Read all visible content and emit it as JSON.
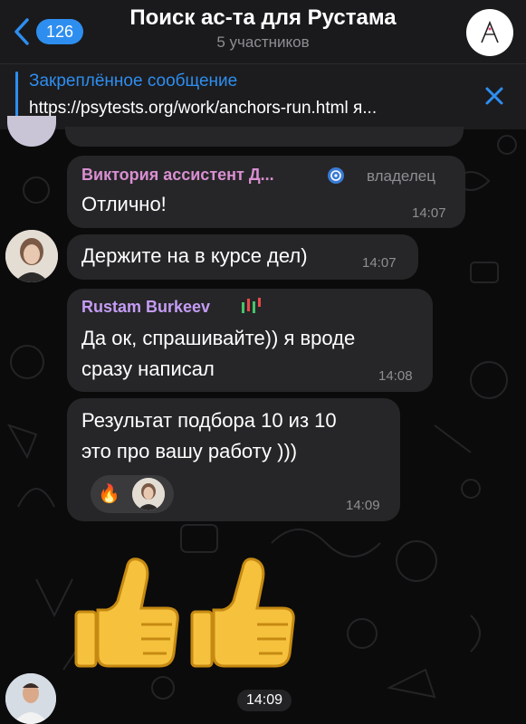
{
  "header": {
    "back_count": "126",
    "title": "Поиск ас-та для Рустама",
    "subtitle": "5 участников"
  },
  "pinned": {
    "title": "Закреплённое сообщение",
    "text": "https://psytests.org/work/anchors-run.html я..."
  },
  "messages": [
    {
      "sender": "Виктория ассистент Д...",
      "role": "владелец",
      "text": "Отлично!",
      "time": "14:07"
    },
    {
      "text": "Держите на в курсе дел)",
      "time": "14:07"
    },
    {
      "sender": "Rustam Burkeev",
      "lines": [
        "Да ок, спрашивайте)) я вроде",
        "сразу написал"
      ],
      "time": "14:08"
    },
    {
      "lines": [
        "Результат подбора 10 из 10",
        "это про вашу работу )))"
      ],
      "reaction": "🔥",
      "time": "14:09"
    },
    {
      "time": "14:09"
    }
  ],
  "colors": {
    "accent": "#2e8ef0",
    "sender_viktoria": "#d98fd1",
    "sender_rustam": "#c49cf5",
    "bubble": "#262628"
  }
}
